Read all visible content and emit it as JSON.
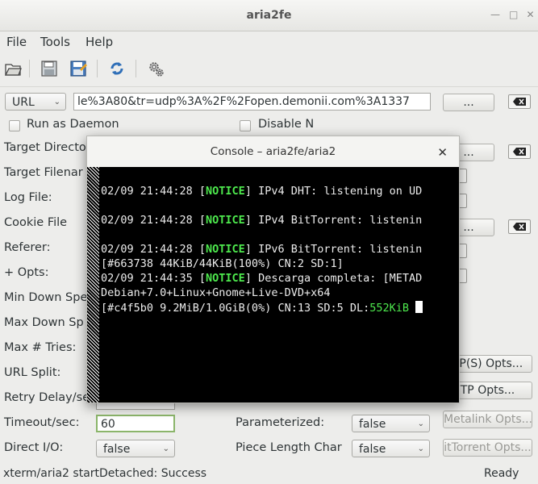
{
  "window": {
    "title": "aria2fe"
  },
  "menu": {
    "file": "File",
    "tools": "Tools",
    "help": "Help"
  },
  "toolbar": {
    "icons": [
      "open-icon",
      "save-icon",
      "save-as-icon",
      "refresh-icon",
      "settings-icon"
    ]
  },
  "url_row": {
    "mode": "URL",
    "value": "le%3A80&tr=udp%3A%2F%2Fopen.demonii.com%3A1337",
    "browse": "..."
  },
  "checks": {
    "daemon": "Run as Daemon",
    "disable": "Disable N"
  },
  "form": {
    "target_directory": "Target Directo",
    "target_filename": "Target Filenar",
    "log_file": "Log File:",
    "cookie_file": "Cookie File",
    "referer": "Referer:",
    "opts": "+ Opts:",
    "min_down": "Min Down Spe",
    "max_down": "Max Down Sp",
    "max_tries": "Max # Tries:",
    "url_split": "URL Split:",
    "retry_delay": "Retry Delay/se",
    "timeout": "Timeout/sec:",
    "timeout_value": "60",
    "direct_io": "Direct I/O:",
    "direct_io_value": "false",
    "parameterized": "Parameterized:",
    "parameterized_value": "false",
    "piece_length": "Piece Length Char",
    "piece_length_value": "false"
  },
  "buttons": {
    "browse": "...",
    "https_opts": "TP(S) Opts...",
    "ftp_opts": "TP Opts...",
    "metalink_opts": "Metalink Opts...",
    "bittorrent_opts": "itTorrent Opts..."
  },
  "console": {
    "title": "Console – aria2fe/aria2",
    "lines": [
      {
        "pre": "02/09 21:44:28 [",
        "tag": "NOTICE",
        "post": "] IPv4 DHT: listening on UD"
      },
      {
        "pre": "02/09 21:44:28 [",
        "tag": "NOTICE",
        "post": "] IPv4 BitTorrent: listenin"
      },
      {
        "pre": "02/09 21:44:28 [",
        "tag": "NOTICE",
        "post": "] IPv6 BitTorrent: listenin"
      },
      {
        "pre": "[#663738 44KiB/44KiB(100%) CN:2 SD:1]",
        "tag": "",
        "post": ""
      },
      {
        "pre": "02/09 21:44:35 [",
        "tag": "NOTICE",
        "post": "] Descarga completa: [METAD"
      },
      {
        "pre": "Debian+7.0+Linux+Gnome+Live-DVD+x64",
        "tag": "",
        "post": ""
      },
      {
        "pre": "[#c4f5b0 9.2MiB/1.0GiB(0%) CN:13 SD:5 DL:",
        "speed": "552KiB"
      }
    ]
  },
  "status": {
    "left": "xterm/aria2 startDetached: Success",
    "right": "Ready"
  }
}
